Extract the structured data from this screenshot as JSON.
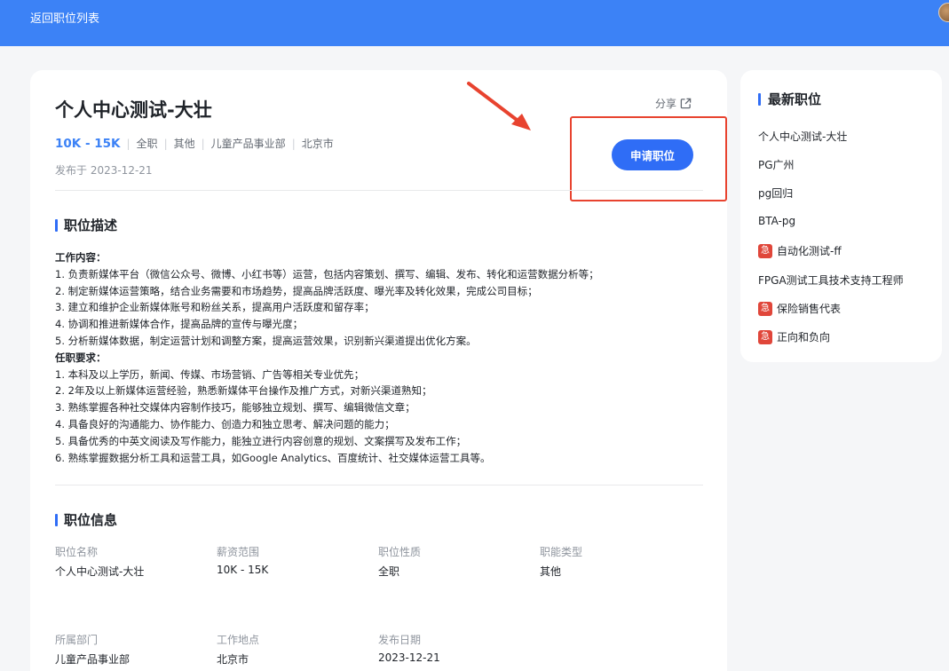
{
  "header": {
    "back_label": "返回职位列表"
  },
  "job": {
    "title": "个人中心测试-大壮",
    "share_label": "分享",
    "salary": "10K - 15K",
    "type": "全职",
    "category": "其他",
    "department": "儿童产品事业部",
    "city": "北京市",
    "posted": "发布于 2023-12-21",
    "apply_label": "申请职位"
  },
  "description": {
    "section_title": "职位描述",
    "lines": [
      {
        "text": "工作内容：",
        "heading": true
      },
      {
        "text": "1. 负责新媒体平台（微信公众号、微博、小红书等）运营，包括内容策划、撰写、编辑、发布、转化和运营数据分析等；",
        "heading": false
      },
      {
        "text": "2. 制定新媒体运营策略，结合业务需要和市场趋势，提高品牌活跃度、曝光率及转化效果，完成公司目标；",
        "heading": false
      },
      {
        "text": "3. 建立和维护企业新媒体账号和粉丝关系，提高用户活跃度和留存率；",
        "heading": false
      },
      {
        "text": "4. 协调和推进新媒体合作，提高品牌的宣传与曝光度；",
        "heading": false
      },
      {
        "text": "5. 分析新媒体数据，制定运营计划和调整方案，提高运营效果，识别新兴渠道提出优化方案。",
        "heading": false
      },
      {
        "text": "任职要求：",
        "heading": true
      },
      {
        "text": "1. 本科及以上学历，新闻、传媒、市场营销、广告等相关专业优先；",
        "heading": false
      },
      {
        "text": "2. 2年及以上新媒体运营经验，熟悉新媒体平台操作及推广方式，对新兴渠道熟知；",
        "heading": false
      },
      {
        "text": "3. 熟练掌握各种社交媒体内容制作技巧，能够独立规划、撰写、编辑微信文章；",
        "heading": false
      },
      {
        "text": "4. 具备良好的沟通能力、协作能力、创造力和独立思考、解决问题的能力；",
        "heading": false
      },
      {
        "text": "5. 具备优秀的中英文阅读及写作能力，能独立进行内容创意的规划、文案撰写及发布工作；",
        "heading": false
      },
      {
        "text": "6. 熟练掌握数据分析工具和运营工具，如Google Analytics、百度统计、社交媒体运营工具等。",
        "heading": false
      }
    ]
  },
  "info": {
    "section_title": "职位信息",
    "fields": [
      {
        "label": "职位名称",
        "value": "个人中心测试-大壮"
      },
      {
        "label": "薪资范围",
        "value": "10K - 15K"
      },
      {
        "label": "职位性质",
        "value": "全职"
      },
      {
        "label": "职能类型",
        "value": "其他"
      },
      {
        "label": "所属部门",
        "value": "儿童产品事业部"
      },
      {
        "label": "工作地点",
        "value": "北京市"
      },
      {
        "label": "发布日期",
        "value": "2023-12-21"
      }
    ]
  },
  "sidebar": {
    "title": "最新职位",
    "urgent_badge": "急",
    "items": [
      {
        "label": "个人中心测试-大壮",
        "urgent": false
      },
      {
        "label": "PG广州",
        "urgent": false
      },
      {
        "label": "pg回归",
        "urgent": false
      },
      {
        "label": "BTA-pg",
        "urgent": false
      },
      {
        "label": "自动化测试-ff",
        "urgent": true
      },
      {
        "label": "FPGA测试工具技术支持工程师",
        "urgent": false
      },
      {
        "label": "保险销售代表",
        "urgent": true
      },
      {
        "label": "正向和负向",
        "urgent": true
      }
    ]
  },
  "colors": {
    "header_bg": "#3c82f6",
    "accent": "#2f6df6",
    "urgent": "#e0463a",
    "annotation": "#e8432f"
  }
}
